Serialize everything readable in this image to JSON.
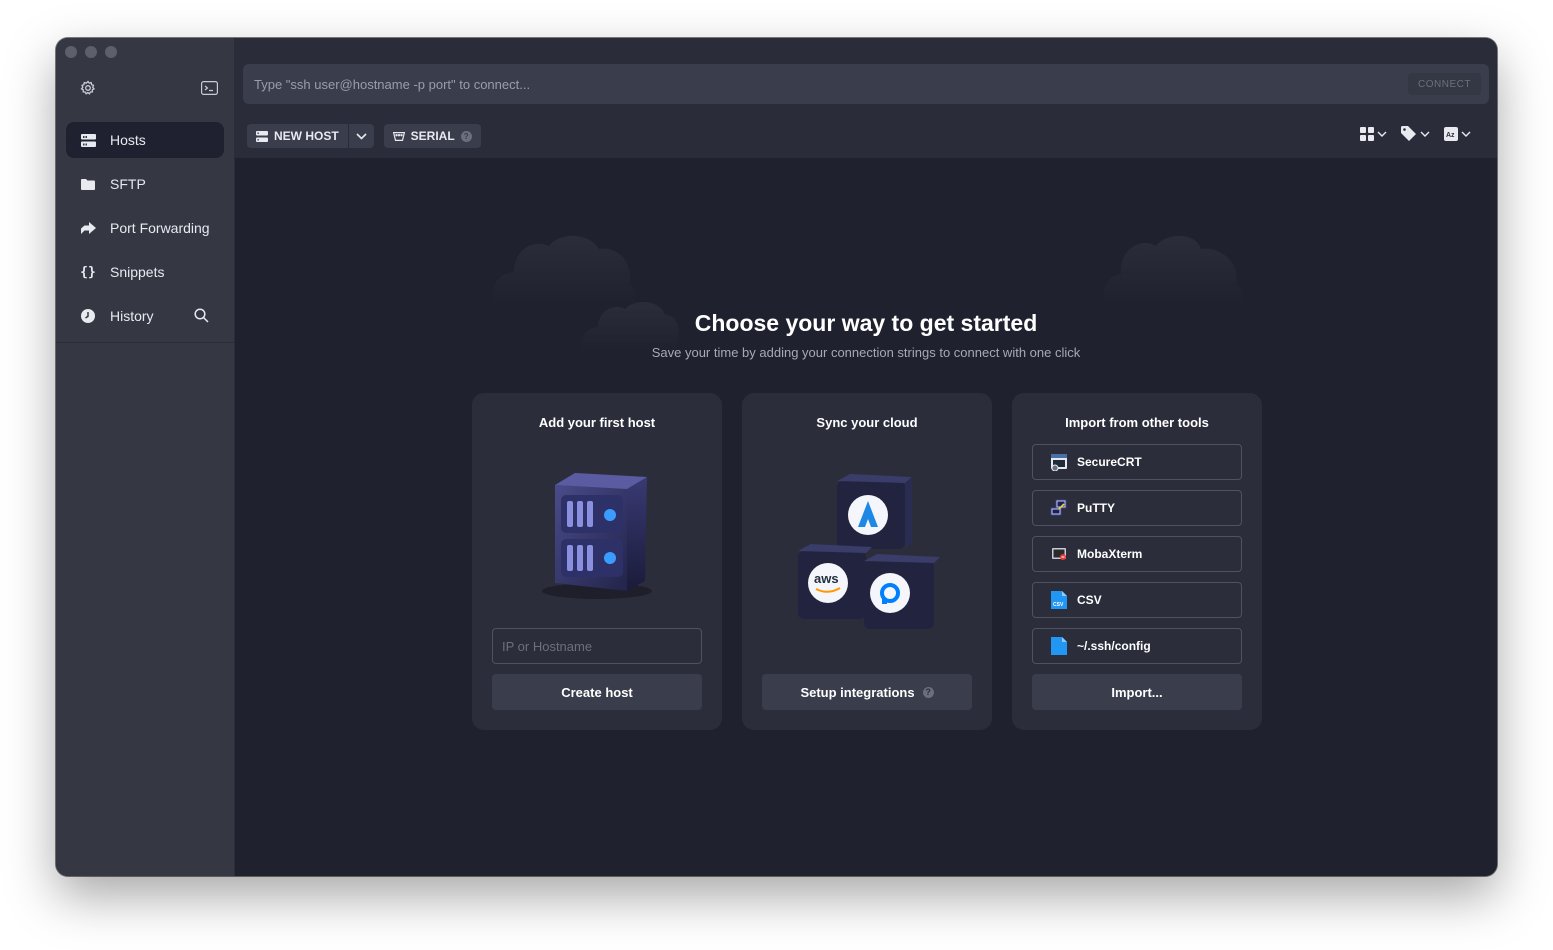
{
  "sidebar": {
    "items": [
      {
        "label": "Hosts",
        "icon": "hosts-icon",
        "active": true
      },
      {
        "label": "SFTP",
        "icon": "folder-icon"
      },
      {
        "label": "Port Forwarding",
        "icon": "port-forwarding-icon"
      },
      {
        "label": "Snippets",
        "icon": "braces-icon"
      },
      {
        "label": "History",
        "icon": "history-icon"
      }
    ]
  },
  "command": {
    "placeholder": "Type \"ssh user@hostname -p port\" to connect...",
    "connect_label": "CONNECT"
  },
  "toolbar": {
    "new_host_label": "NEW HOST",
    "serial_label": "SERIAL"
  },
  "hero": {
    "title": "Choose your way to get started",
    "subtitle": "Save your time by adding your connection strings to connect with one click"
  },
  "cards": {
    "add_host": {
      "title": "Add your first host",
      "input_placeholder": "IP or Hostname",
      "button_label": "Create host"
    },
    "sync_cloud": {
      "title": "Sync your cloud",
      "button_label": "Setup integrations"
    },
    "import": {
      "title": "Import from other tools",
      "tools": [
        "SecureCRT",
        "PuTTY",
        "MobaXterm",
        "CSV",
        "~/.ssh/config"
      ],
      "button_label": "Import..."
    }
  },
  "colors": {
    "background": "#1f212e",
    "sidebar": "#353843",
    "card": "#2b2d3a",
    "accent": "#3b9cff"
  }
}
